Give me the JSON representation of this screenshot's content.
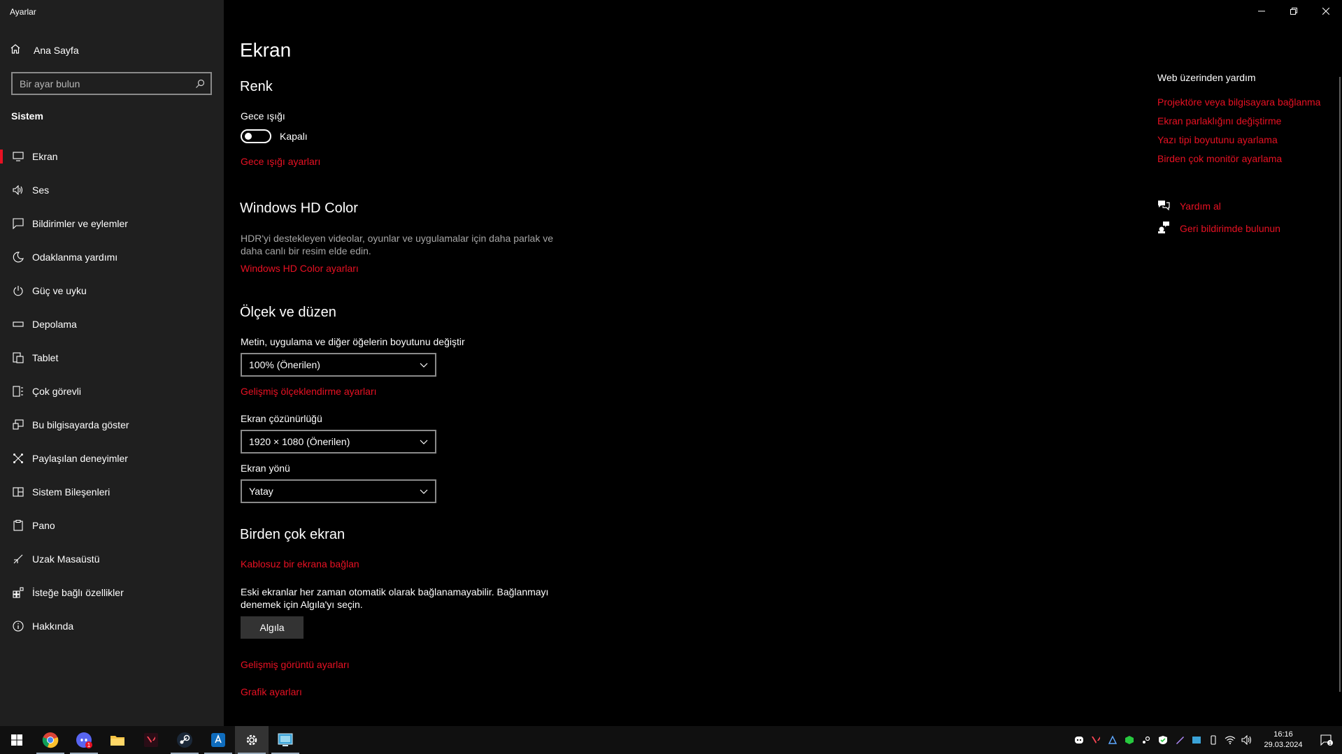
{
  "window": {
    "title": "Ayarlar",
    "controls": [
      "minimize",
      "restore",
      "close"
    ]
  },
  "sidebar": {
    "home_label": "Ana Sayfa",
    "search_placeholder": "Bir ayar bulun",
    "section_label": "Sistem",
    "items": [
      {
        "label": "Ekran",
        "icon": "display-icon",
        "active": true
      },
      {
        "label": "Ses",
        "icon": "speaker-icon"
      },
      {
        "label": "Bildirimler ve eylemler",
        "icon": "notification-icon"
      },
      {
        "label": "Odaklanma yardımı",
        "icon": "moon-icon"
      },
      {
        "label": "Güç ve uyku",
        "icon": "power-icon"
      },
      {
        "label": "Depolama",
        "icon": "storage-icon"
      },
      {
        "label": "Tablet",
        "icon": "tablet-icon"
      },
      {
        "label": "Çok görevli",
        "icon": "multitasking-icon"
      },
      {
        "label": "Bu bilgisayarda göster",
        "icon": "project-icon"
      },
      {
        "label": "Paylaşılan deneyimler",
        "icon": "shared-icon"
      },
      {
        "label": "Sistem Bileşenleri",
        "icon": "components-icon"
      },
      {
        "label": "Pano",
        "icon": "clipboard-icon"
      },
      {
        "label": "Uzak Masaüstü",
        "icon": "remote-icon"
      },
      {
        "label": "İsteğe bağlı özellikler",
        "icon": "features-icon"
      },
      {
        "label": "Hakkında",
        "icon": "info-icon"
      }
    ]
  },
  "main": {
    "title": "Ekran",
    "color": {
      "heading": "Renk",
      "night_light_label": "Gece ışığı",
      "night_light_state": "Kapalı",
      "night_light_link": "Gece ışığı ayarları"
    },
    "hdr": {
      "heading": "Windows HD Color",
      "description": "HDR'yi destekleyen videolar, oyunlar ve uygulamalar için daha parlak ve daha canlı bir resim elde edin.",
      "link": "Windows HD Color ayarları"
    },
    "scale": {
      "heading": "Ölçek ve düzen",
      "size_label": "Metin, uygulama ve diğer öğelerin boyutunu değiştir",
      "size_value": "100% (Önerilen)",
      "advanced_link": "Gelişmiş ölçeklendirme ayarları",
      "resolution_label": "Ekran çözünürlüğü",
      "resolution_value": "1920 × 1080 (Önerilen)",
      "orientation_label": "Ekran yönü",
      "orientation_value": "Yatay"
    },
    "multi": {
      "heading": "Birden çok ekran",
      "wireless_link": "Kablosuz bir ekrana bağlan",
      "description": "Eski ekranlar her zaman otomatik olarak bağlanamayabilir. Bağlanmayı denemek için Algıla'yı seçin.",
      "detect_button": "Algıla",
      "advanced_display_link": "Gelişmiş görüntü ayarları",
      "graphics_link": "Grafik ayarları"
    }
  },
  "help": {
    "title": "Web üzerinden yardım",
    "links": [
      "Projektöre veya bilgisayara bağlanma",
      "Ekran parlaklığını değiştirme",
      "Yazı tipi boyutunu ayarlama",
      "Birden çok monitör ayarlama"
    ],
    "get_help": "Yardım al",
    "feedback": "Geri bildirimde bulunun"
  },
  "taskbar": {
    "apps": [
      "chrome-icon",
      "discord-icon",
      "file-explorer-icon",
      "valorant-icon",
      "steam-icon",
      "app-store-icon",
      "settings-icon",
      "control-panel-icon"
    ],
    "notification_badge": "1",
    "time": "16:16",
    "date": "29.03.2024",
    "action_center_count": "1"
  }
}
